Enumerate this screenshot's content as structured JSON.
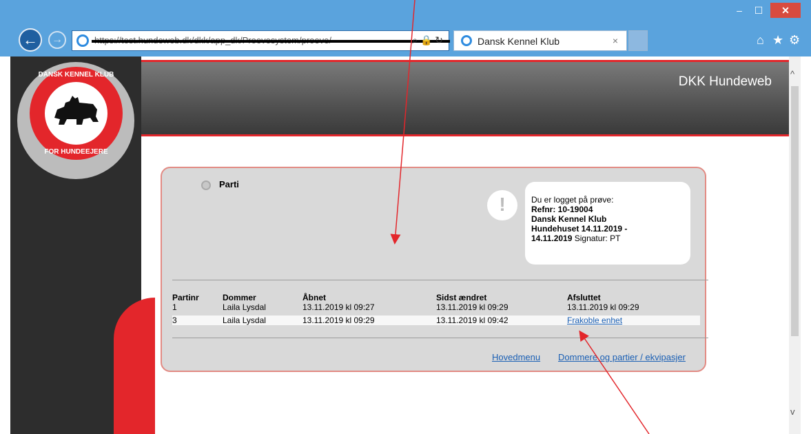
{
  "browser": {
    "url": "https://test.hundeweb.dk/dkk/app_dk/Proevesystem/proeve/",
    "tab_title": "Dansk Kennel Klub",
    "tab_close": "×",
    "window_min": "–",
    "window_max": "☐",
    "window_close": "✕"
  },
  "header": {
    "title": "DKK Hundeweb",
    "logo_top": "DANSK KENNEL KLUB",
    "logo_bottom": "FOR HUNDEEJERE"
  },
  "panel": {
    "section_label": "Parti",
    "notice": {
      "line1": "Du er logget på prøve:",
      "line2": "Refnr: 10-19004",
      "line3": "Dansk Kennel Klub",
      "line4": "Hundehuset 14.11.2019 -",
      "line5_bold": "14.11.2019",
      "line5_rest": " Signatur: PT"
    },
    "table": {
      "headers": [
        "Partinr",
        "Dommer",
        "Åbnet",
        "Sidst ændret",
        "Afsluttet"
      ],
      "rows": [
        {
          "partinr": "1",
          "dommer": "Laila Lysdal",
          "aabnet": "13.11.2019 kl 09:27",
          "sidst": "13.11.2019 kl 09:29",
          "afsluttet": "13.11.2019 kl 09:29"
        },
        {
          "partinr": "3",
          "dommer": "Laila Lysdal",
          "aabnet": "13.11.2019 kl 09:29",
          "sidst": "13.11.2019 kl 09:42",
          "afsluttet": "Frakoble enhet"
        }
      ]
    },
    "footer": {
      "main_menu": "Hovedmenu",
      "judges_link": "Dommere og partier / ekvipasjer"
    }
  },
  "colors": {
    "accent_red": "#e3262b",
    "chrome_blue": "#5aa3dd",
    "link_blue": "#1a5fb4"
  }
}
